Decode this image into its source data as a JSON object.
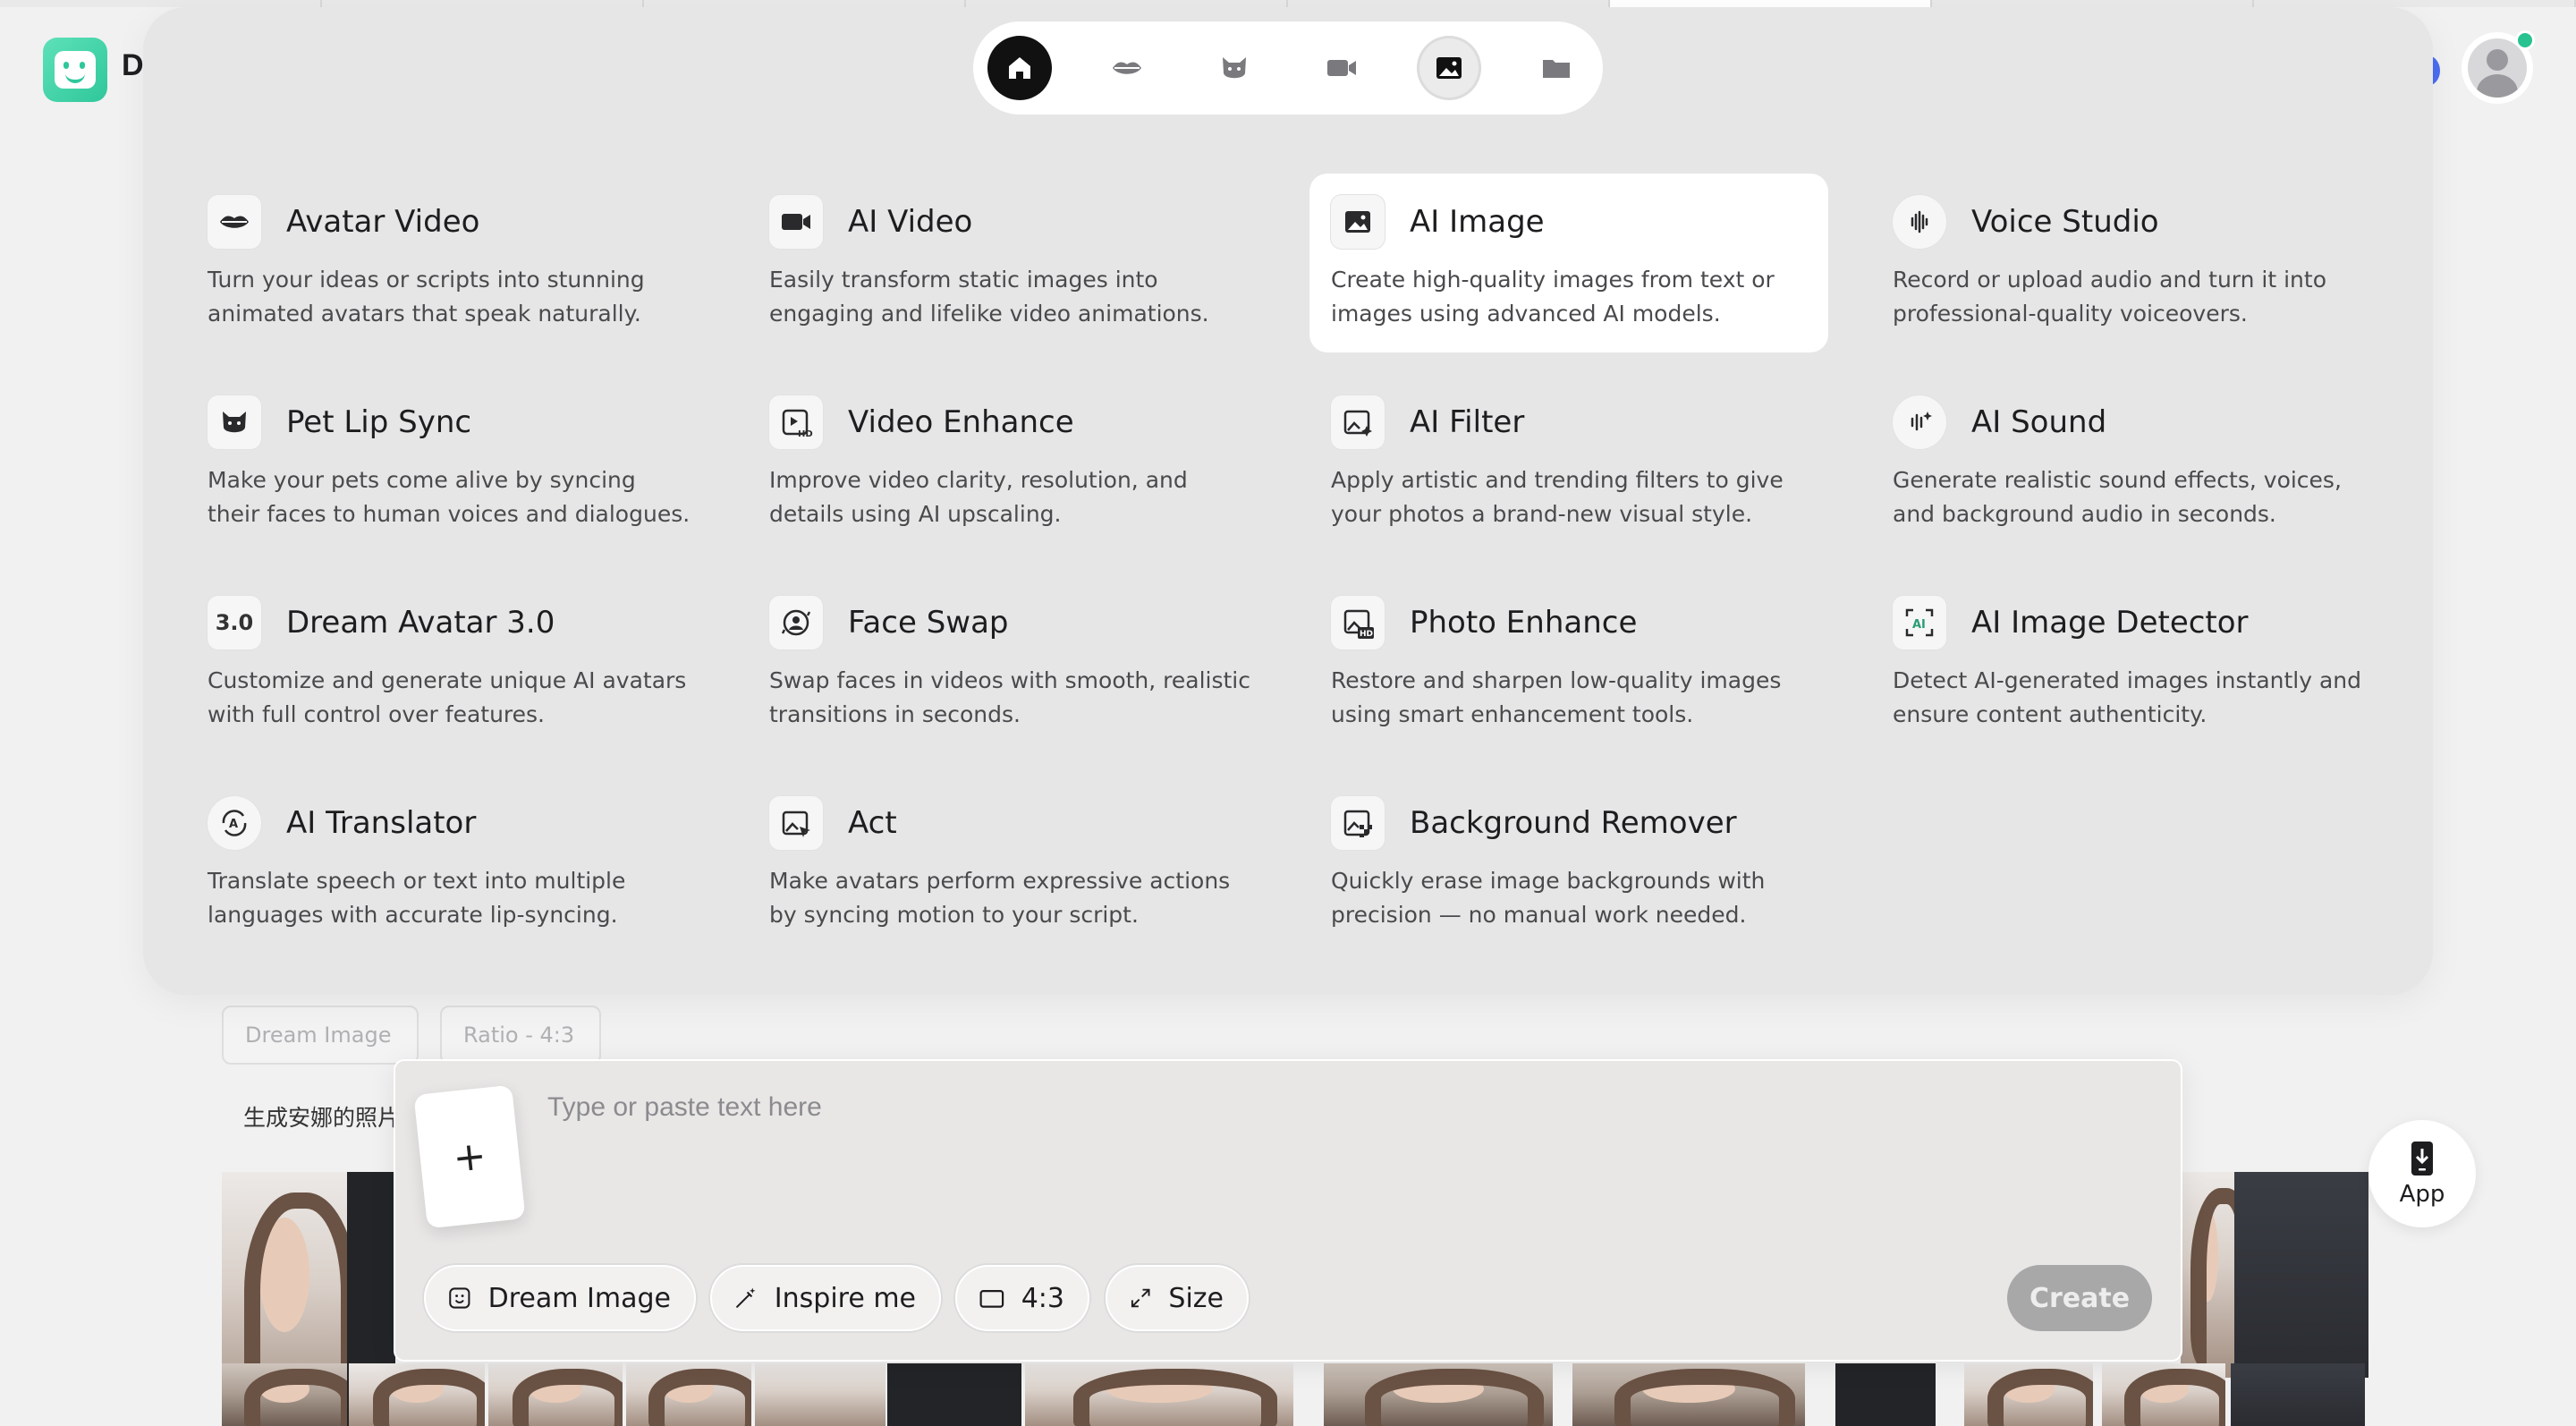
{
  "brand": {
    "initial": "D"
  },
  "nav": {
    "icons": [
      "home-icon",
      "lips-icon",
      "cat-icon",
      "video-camera-icon",
      "image-icon",
      "folder-icon"
    ],
    "selected": "image-icon"
  },
  "features": [
    {
      "id": "avatar-video",
      "icon": "lips-icon",
      "title": "Avatar Video",
      "desc": "Turn your ideas or scripts into stunning animated avatars that speak naturally."
    },
    {
      "id": "ai-video",
      "icon": "video-camera-icon",
      "title": "AI Video",
      "desc": "Easily transform static images into engaging and lifelike video animations."
    },
    {
      "id": "ai-image",
      "icon": "image-icon",
      "title": "AI Image",
      "desc": "Create high-quality images from text or images using advanced AI models."
    },
    {
      "id": "voice-studio",
      "icon": "sound-wave-icon",
      "title": "Voice Studio",
      "desc": "Record or upload audio and turn it into professional-quality voiceovers."
    },
    {
      "id": "pet-lip-sync",
      "icon": "cat-icon",
      "title": "Pet Lip Sync",
      "desc": "Make your pets come alive by syncing their faces to human voices and dialogues."
    },
    {
      "id": "video-enhance",
      "icon": "video-hd-icon",
      "title": "Video Enhance",
      "desc": "Improve video clarity, resolution, and details using AI upscaling."
    },
    {
      "id": "ai-filter",
      "icon": "filter-icon",
      "title": "AI Filter",
      "desc": "Apply artistic and trending filters to give your photos a brand-new visual style."
    },
    {
      "id": "ai-sound",
      "icon": "sparkle-sound-icon",
      "title": "AI Sound",
      "desc": "Generate realistic sound effects, voices, and background audio in seconds."
    },
    {
      "id": "dream-avatar",
      "icon": "version-icon",
      "icon_text": "3.0",
      "title": "Dream Avatar 3.0",
      "desc": "Customize and generate unique AI avatars with full control over features."
    },
    {
      "id": "face-swap",
      "icon": "face-swap-icon",
      "title": "Face Swap",
      "desc": "Swap faces in videos with smooth, realistic transitions in seconds."
    },
    {
      "id": "photo-enhance",
      "icon": "photo-hd-icon",
      "title": "Photo Enhance",
      "desc": "Restore and sharpen low-quality images using smart enhancement tools."
    },
    {
      "id": "ai-image-detector",
      "icon": "ai-detect-icon",
      "title": "AI Image Detector",
      "desc": "Detect AI-generated images instantly and ensure content authenticity."
    },
    {
      "id": "ai-translator",
      "icon": "translate-icon",
      "title": "AI Translator",
      "desc": "Translate speech or text into multiple languages with accurate lip-syncing."
    },
    {
      "id": "act",
      "icon": "act-icon",
      "title": "Act",
      "desc": "Make avatars perform expressive actions by syncing motion to your script."
    },
    {
      "id": "background-remover",
      "icon": "bg-remove-icon",
      "title": "Background Remover",
      "desc": "Quickly erase image backgrounds with precision — no manual work needed."
    }
  ],
  "history": {
    "chips": [
      "Dream Image",
      "Ratio - 4:3"
    ],
    "prompt": "生成安娜的照片"
  },
  "composer": {
    "add_label": "+",
    "placeholder": "Type or paste text here",
    "model_label": "Dream Image",
    "inspire_label": "Inspire me",
    "ratio_label": "4:3",
    "size_label": "Size",
    "create_label": "Create"
  },
  "app_button": {
    "label": "App"
  },
  "colors": {
    "brand": "#2fc79b",
    "online": "#27c28f",
    "create_disabled": "#a9a8a8"
  }
}
